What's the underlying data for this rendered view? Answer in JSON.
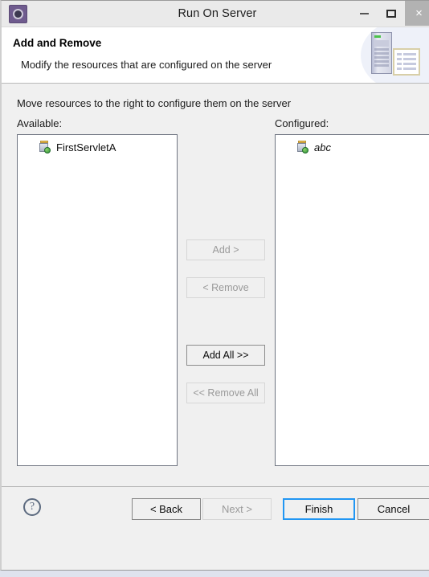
{
  "window": {
    "title": "Run On Server",
    "app_icon": "run-on-server-icon",
    "controls": {
      "minimize": "–",
      "maximize": "□",
      "close": "×"
    }
  },
  "header": {
    "title": "Add and Remove",
    "description": "Modify the resources that are configured on the server",
    "art": {
      "server_icon": "server-tower-icon",
      "document_icon": "document-list-icon"
    }
  },
  "main": {
    "instruction": "Move resources to the right to configure them on the server",
    "available": {
      "label": "Available:",
      "items": [
        {
          "label": "FirstServletA",
          "icon": "web-module-icon",
          "italic": false
        }
      ]
    },
    "configured": {
      "label": "Configured:",
      "items": [
        {
          "label": "abc",
          "icon": "web-module-icon",
          "italic": true
        }
      ]
    },
    "transfer_buttons": [
      {
        "label": "Add >",
        "enabled": false
      },
      {
        "label": "< Remove",
        "enabled": false
      },
      {
        "label": "Add All >>",
        "enabled": true
      },
      {
        "label": "<< Remove All",
        "enabled": false
      }
    ]
  },
  "footer": {
    "help_label": "?",
    "buttons": [
      {
        "label": "< Back",
        "state": "enabled"
      },
      {
        "label": "Next >",
        "state": "disabled"
      },
      {
        "label": "Finish",
        "state": "focused"
      },
      {
        "label": "Cancel",
        "state": "enabled"
      }
    ]
  },
  "colors": {
    "dialog_background": "#f0f0f0",
    "header_background": "#ffffff",
    "focus_border": "#2196f3",
    "disabled_text": "#9a9a9a",
    "desktop_background": "#dfe3ee",
    "close_button_background": "#b2b2b2"
  }
}
